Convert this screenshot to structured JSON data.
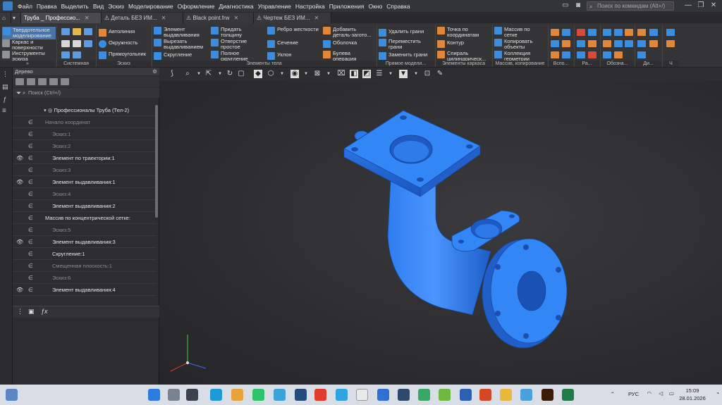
{
  "menubar": {
    "items": [
      "Файл",
      "Правка",
      "Выделить",
      "Вид",
      "Эскиз",
      "Моделирование",
      "Оформление",
      "Диагностика",
      "Управление",
      "Настройка",
      "Приложения",
      "Окно",
      "Справка"
    ],
    "search_placeholder": "Поиск по командам (Alt+/)"
  },
  "tabs": [
    {
      "label": "Труба _ Профессио...",
      "active": true
    },
    {
      "label": "Деталь БЕЗ ИМ...",
      "active": false
    },
    {
      "label": "Black point.frw",
      "active": false
    },
    {
      "label": "Чертеж БЕЗ ИМ...",
      "active": false
    }
  ],
  "ribbon": {
    "modes": [
      "Твердотельное моделирование",
      "Каркас и поверхности",
      "Инструменты эскиза"
    ],
    "groups": [
      "Системная",
      "Эскиз",
      "Элементы тела",
      "Прямое модели...",
      "Элементы каркаса",
      "Массив, копирование",
      "Вспо...",
      "Ра...",
      "Обозна...",
      "Ди...",
      "Ч"
    ],
    "sketch": [
      "Автолиния",
      "Окружность",
      "Прямоугольник"
    ],
    "body1": [
      "Элемент выдавливания",
      "Вырезать выдавливанием",
      "Скругление"
    ],
    "body2": [
      "Придать толщину",
      "Отверстие простое",
      "Полное скругление"
    ],
    "body3": [
      "Ребро жесткости",
      "Сечение",
      "Уклон"
    ],
    "body4": [
      "Добавить деталь-загото...",
      "Оболочка",
      "Булева операция"
    ],
    "direct": [
      "Удалить грани",
      "Переместить грани",
      "Заменить грани"
    ],
    "frame": [
      "Точка по координатам",
      "Контур",
      "Спираль цилиндрическ..."
    ],
    "array": [
      "Массив по сетке",
      "Копировать объекты",
      "Коллекция геометрии"
    ]
  },
  "tree": {
    "title": "Дерево",
    "search": "Поиск (Ctrl+/)",
    "root": "Профессионалы  Труба (Тел-2)",
    "items": [
      {
        "label": "Начало координат",
        "eye": "",
        "state": "dim",
        "indent": 1
      },
      {
        "label": "Эскиз:1",
        "eye": "",
        "state": "dim",
        "indent": 2
      },
      {
        "label": "Эскиз:2",
        "eye": "",
        "state": "dim",
        "indent": 2
      },
      {
        "label": "Элемент по траектории:1",
        "eye": "👁",
        "state": "on",
        "indent": 2
      },
      {
        "label": "Эскиз:3",
        "eye": "",
        "state": "dim",
        "indent": 2
      },
      {
        "label": "Элемент выдавливания:1",
        "eye": "👁",
        "state": "on",
        "indent": 2
      },
      {
        "label": "Эскиз:4",
        "eye": "",
        "state": "dim",
        "indent": 2
      },
      {
        "label": "Элемент выдавливания:2",
        "eye": "",
        "state": "on",
        "indent": 2
      },
      {
        "label": "Массив по концентрической сетке:",
        "eye": "",
        "state": "on",
        "indent": 1
      },
      {
        "label": "Эскиз:5",
        "eye": "",
        "state": "dim",
        "indent": 2
      },
      {
        "label": "Элемент выдавливания:3",
        "eye": "👁",
        "state": "on",
        "indent": 2
      },
      {
        "label": "Скругление:1",
        "eye": "",
        "state": "on",
        "indent": 2
      },
      {
        "label": "Смещенная плоскость:1",
        "eye": "",
        "state": "dim",
        "indent": 2
      },
      {
        "label": "Эскиз:6",
        "eye": "",
        "state": "dim",
        "indent": 2
      },
      {
        "label": "Элемент выдавливания:4",
        "eye": "👁",
        "state": "on",
        "indent": 2
      }
    ]
  },
  "tray": {
    "lang": "РУС",
    "time": "15:09",
    "date": "28.01.2026"
  },
  "colors": {
    "part": "#2f7ef0",
    "partDark": "#1b56b8",
    "partLight": "#5da3ff"
  }
}
